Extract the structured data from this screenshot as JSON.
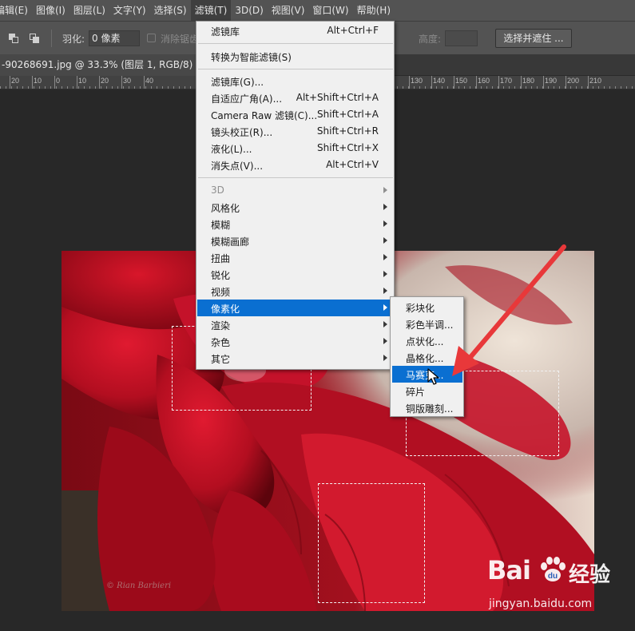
{
  "menubar": {
    "items": [
      "编辑(E)",
      "图像(I)",
      "图层(L)",
      "文字(Y)",
      "选择(S)",
      "滤镜(T)",
      "3D(D)",
      "视图(V)",
      "窗口(W)",
      "帮助(H)"
    ]
  },
  "options": {
    "feather_label": "羽化:",
    "feather_value": "0 像素",
    "antialias_label": "消除锯齿",
    "height_label": "高度:",
    "select_mask_label": "选择并遮住 ..."
  },
  "document": {
    "tab_title": "-90268691.jpg @ 33.3% (图层 1, RGB/8) *",
    "close_glyph": "×"
  },
  "ruler": {
    "labels": [
      "20",
      "10",
      "0",
      "10",
      "20",
      "30",
      "40",
      "130",
      "140",
      "150",
      "160",
      "170",
      "180",
      "190",
      "200",
      "210"
    ]
  },
  "filter_menu": {
    "items": [
      {
        "label": "滤镜库",
        "shortcut": "Alt+Ctrl+F"
      },
      {
        "label": "转换为智能滤镜(S)",
        "shortcut": ""
      },
      {
        "label": "滤镜库(G)...",
        "shortcut": ""
      },
      {
        "label": "自适应广角(A)...",
        "shortcut": "Alt+Shift+Ctrl+A"
      },
      {
        "label": "Camera Raw 滤镜(C)...",
        "shortcut": "Shift+Ctrl+A"
      },
      {
        "label": "镜头校正(R)...",
        "shortcut": "Shift+Ctrl+R"
      },
      {
        "label": "液化(L)...",
        "shortcut": "Shift+Ctrl+X"
      },
      {
        "label": "消失点(V)...",
        "shortcut": "Alt+Ctrl+V"
      },
      {
        "label": "3D",
        "shortcut": ""
      },
      {
        "label": "风格化",
        "shortcut": ""
      },
      {
        "label": "模糊",
        "shortcut": ""
      },
      {
        "label": "模糊画廊",
        "shortcut": ""
      },
      {
        "label": "扭曲",
        "shortcut": ""
      },
      {
        "label": "锐化",
        "shortcut": ""
      },
      {
        "label": "视频",
        "shortcut": ""
      },
      {
        "label": "像素化",
        "shortcut": ""
      },
      {
        "label": "渲染",
        "shortcut": ""
      },
      {
        "label": "杂色",
        "shortcut": ""
      },
      {
        "label": "其它",
        "shortcut": ""
      }
    ]
  },
  "pixelate_submenu": {
    "items": [
      "彩块化",
      "彩色半调...",
      "点状化...",
      "晶格化...",
      "马赛克...",
      "碎片",
      "铜版雕刻..."
    ]
  },
  "photo": {
    "signature": "© Rian Barbieri"
  },
  "watermark": {
    "brand": "Bai",
    "brand_cn": "经验",
    "url": "jingyan.baidu.com"
  },
  "colors": {
    "highlight": "#0a6fd1",
    "annotation_arrow": "#e8383a",
    "menubar_bg": "#535353"
  }
}
